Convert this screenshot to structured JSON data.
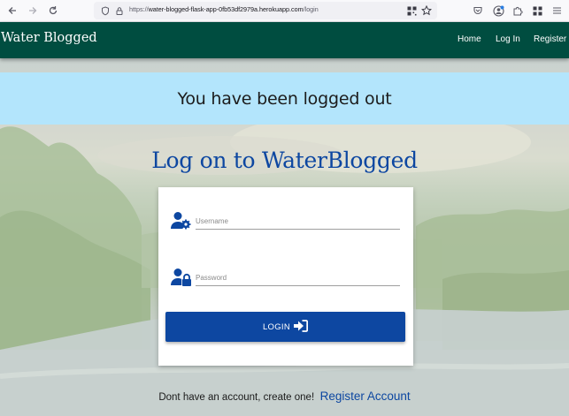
{
  "browser": {
    "url_prefix": "https://",
    "url_host": "water-blogged-flask-app-0fb53df2979a.herokuapp.com",
    "url_path": "/login"
  },
  "navbar": {
    "brand": "Water Blogged",
    "links": [
      "Home",
      "Log In",
      "Register"
    ]
  },
  "flash": {
    "message": "You have been logged out"
  },
  "page": {
    "heading": "Log on to WaterBlogged"
  },
  "form": {
    "username_placeholder": "Username",
    "password_placeholder": "Password",
    "login_label": "LOGIN"
  },
  "footer": {
    "prompt": "Dont have an account, create one!",
    "register_link": "Register Account"
  },
  "colors": {
    "navbar": "#004d40",
    "flash_bg": "#b3e5fc",
    "primary": "#0d47a1"
  },
  "icons": {
    "back": "arrow-left-icon",
    "forward": "arrow-right-icon",
    "reload": "reload-icon",
    "username": "user-gear-icon",
    "password": "user-lock-icon",
    "login": "sign-in-icon"
  }
}
